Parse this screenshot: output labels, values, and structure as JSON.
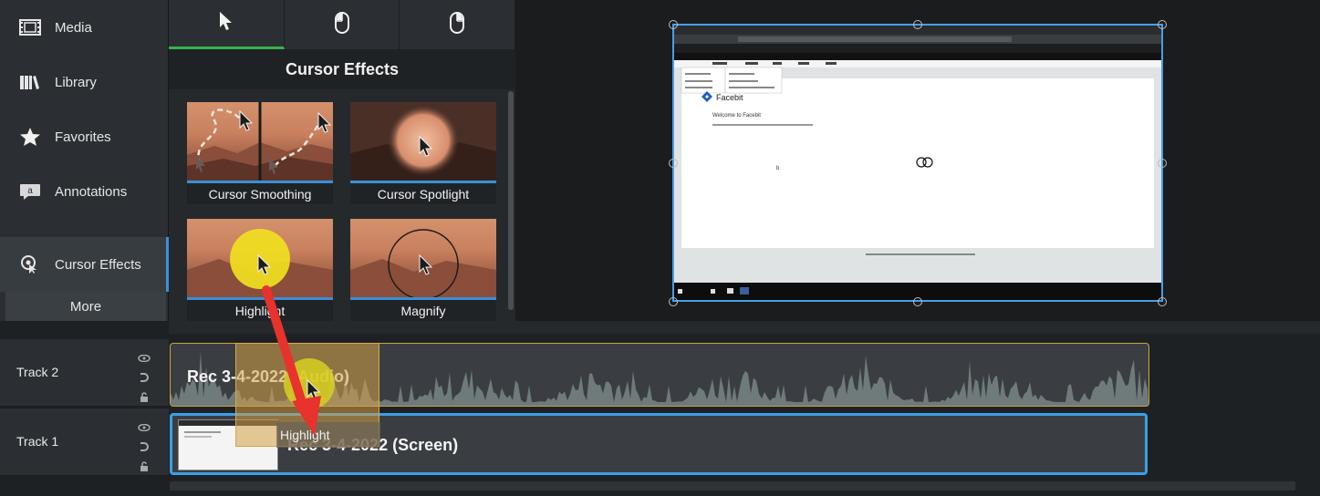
{
  "sidebar": {
    "items": [
      {
        "label": "Media",
        "icon": "film-strip-icon"
      },
      {
        "label": "Library",
        "icon": "books-icon"
      },
      {
        "label": "Favorites",
        "icon": "star-icon"
      },
      {
        "label": "Annotations",
        "icon": "annotation-icon"
      },
      {
        "label": "Cursor Effects",
        "icon": "cursor-effects-icon"
      }
    ],
    "more_label": "More"
  },
  "effects_panel": {
    "tabs": [
      "cursor-arrow-icon",
      "mouse-left-click-icon",
      "mouse-right-click-icon"
    ],
    "title": "Cursor Effects",
    "tiles": [
      {
        "label": "Cursor Smoothing"
      },
      {
        "label": "Cursor Spotlight"
      },
      {
        "label": "Highlight"
      },
      {
        "label": "Magnify"
      }
    ]
  },
  "preview": {
    "browser_page_heading": "Welcome to Facebit",
    "browser_logo_text": "Facebit"
  },
  "timeline": {
    "tracks": [
      {
        "name": "Track 2",
        "clip_title": "Rec 3-4-2022 (Audio)"
      },
      {
        "name": "Track 1",
        "clip_title": "Rec 3-4-2022 (Screen)"
      }
    ],
    "drag_ghost_label": "Highlight"
  },
  "colors": {
    "accent_blue": "#3a8fd8",
    "audio_clip_border": "#c9a63a",
    "active_tab": "#37b24d",
    "annotation_arrow": "#e8322d",
    "highlight_yellow": "#f0e020"
  }
}
